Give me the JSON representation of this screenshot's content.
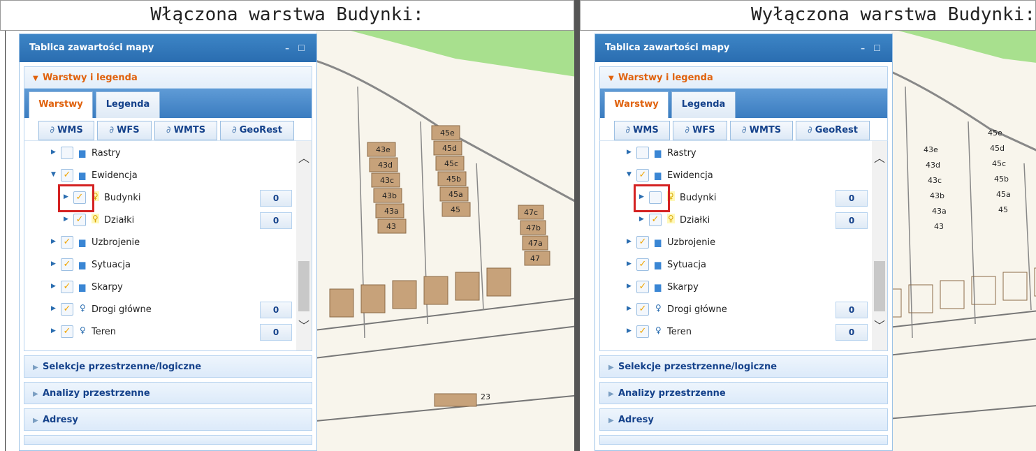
{
  "left": {
    "caption": "Włączona warstwa Budynki:",
    "budynki_checked": "✓"
  },
  "right": {
    "caption": "Wyłączona warstwa Budynki:",
    "budynki_checked": ""
  },
  "panel": {
    "title": "Tablica zawartości mapy",
    "tools": "– ☐",
    "sections": {
      "layers": "Warstwy i legenda",
      "selections": "Selekcje przestrzenne/logiczne",
      "analyses": "Analizy przestrzenne",
      "addresses": "Adresy"
    },
    "tabs": [
      "Warstwy",
      "Legenda"
    ],
    "subtabs": [
      "WMS",
      "WFS",
      "WMTS",
      "GeoRest"
    ],
    "link_glyph": "∂",
    "tree": [
      {
        "label": "Rastry",
        "count": ""
      },
      {
        "label": "Ewidencja",
        "count": ""
      },
      {
        "label": "Budynki",
        "count": "0"
      },
      {
        "label": "Działki",
        "count": "0"
      },
      {
        "label": "Uzbrojenie",
        "count": ""
      },
      {
        "label": "Sytuacja",
        "count": ""
      },
      {
        "label": "Skarpy",
        "count": ""
      },
      {
        "label": "Drogi główne",
        "count": "0"
      },
      {
        "label": "Teren",
        "count": "0"
      }
    ],
    "check": "✓"
  },
  "map": {
    "building_labels_a": [
      "43e",
      "43d",
      "43c",
      "43b",
      "43a",
      "43"
    ],
    "building_labels_b": [
      "45e",
      "45d",
      "45c",
      "45b",
      "45a",
      "45"
    ],
    "building_labels_c": [
      "47c",
      "47b",
      "47a",
      "47"
    ],
    "extra_label": "23"
  },
  "colors": {
    "panel_header": "#2a6db0",
    "accent_orange": "#e0620d",
    "building": "#c7a27a",
    "grass": "#a8e08e",
    "highlight": "#d42222"
  }
}
